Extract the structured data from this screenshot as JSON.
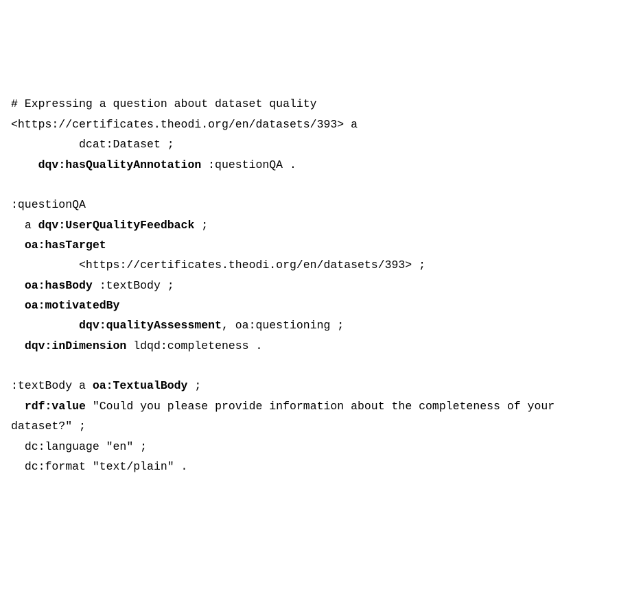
{
  "code": {
    "line01": "# Expressing a question about dataset quality",
    "line02_a": "<https://certificates.theodi.org/en/datasets/393> a",
    "line02_b": "          dcat:Dataset ;",
    "line03_indent": "    ",
    "line03_bold": "dqv:hasQualityAnnotation",
    "line03_tail": " :questionQA .",
    "blank1": "",
    "line04": ":questionQA",
    "line05_indent": "  a ",
    "line05_bold": "dqv:UserQualityFeedback",
    "line05_tail": " ;",
    "line06_indent": "  ",
    "line06_bold": "oa:hasTarget",
    "line07": "          <https://certificates.theodi.org/en/datasets/393> ;",
    "line08_indent": "  ",
    "line08_bold": "oa:hasBody",
    "line08_tail": " :textBody ;",
    "line09_indent": "  ",
    "line09_bold": "oa:motivatedBy",
    "line10_indent": "          ",
    "line10_bold": "dqv:qualityAssessment",
    "line10_tail": ", oa:questioning ;",
    "line11_indent": "  ",
    "line11_bold": "dqv:inDimension",
    "line11_tail": " ldqd:completeness .",
    "blank2": "",
    "line12_a": ":textBody a ",
    "line12_bold": "oa:TextualBody",
    "line12_tail": " ;",
    "line13_indent": "  ",
    "line13_bold": "rdf:value",
    "line13_tail": " \"Could you please provide information about the completeness of your dataset?\" ;",
    "line14": "  dc:language \"en\" ;",
    "line15": "  dc:format \"text/plain\" ."
  }
}
